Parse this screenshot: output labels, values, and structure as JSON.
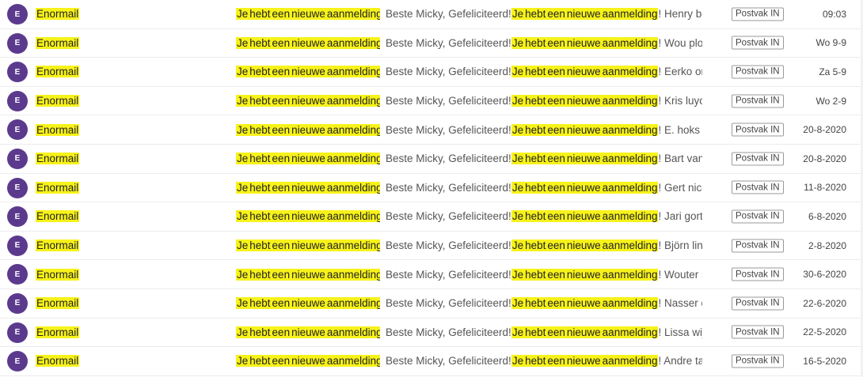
{
  "messages": [
    {
      "avatar": "E",
      "sender": "Enormail",
      "subject_words": [
        "Je",
        "hebt",
        "een",
        "nieuwe",
        "aanmelding"
      ],
      "subject_end": "!",
      "preview_lead": "Beste Micky, Gefeliciteerd!",
      "preview_words": [
        "Je",
        "hebt",
        "een",
        "nieuwe",
        "aanmelding"
      ],
      "preview_tail": "! Henry bok...",
      "folder": "Postvak IN",
      "date": "09:03"
    },
    {
      "avatar": "E",
      "sender": "Enormail",
      "subject_words": [
        "Je",
        "hebt",
        "een",
        "nieuwe",
        "aanmelding"
      ],
      "subject_end": "!",
      "preview_lead": "Beste Micky, Gefeliciteerd!",
      "preview_words": [
        "Je",
        "hebt",
        "een",
        "nieuwe",
        "aanmelding"
      ],
      "preview_tail": "! Wou plou...",
      "folder": "Postvak IN",
      "date": "Wo 9-9"
    },
    {
      "avatar": "E",
      "sender": "Enormail",
      "subject_words": [
        "Je",
        "hebt",
        "een",
        "nieuwe",
        "aanmelding"
      ],
      "subject_end": "!",
      "preview_lead": "Beste Micky, Gefeliciteerd!",
      "preview_words": [
        "Je",
        "hebt",
        "een",
        "nieuwe",
        "aanmelding"
      ],
      "preview_tail": "! Eerko orse...",
      "folder": "Postvak IN",
      "date": "Za 5-9"
    },
    {
      "avatar": "E",
      "sender": "Enormail",
      "subject_words": [
        "Je",
        "hebt",
        "een",
        "nieuwe",
        "aanmelding"
      ],
      "subject_end": "!",
      "preview_lead": "Beste Micky, Gefeliciteerd!",
      "preview_words": [
        "Je",
        "hebt",
        "een",
        "nieuwe",
        "aanmelding"
      ],
      "preview_tail": "! Kris luyckx...",
      "folder": "Postvak IN",
      "date": "Wo 2-9"
    },
    {
      "avatar": "E",
      "sender": "Enormail",
      "subject_words": [
        "Je",
        "hebt",
        "een",
        "nieuwe",
        "aanmelding"
      ],
      "subject_end": "!",
      "preview_lead": "Beste Micky, Gefeliciteerd!",
      "preview_words": [
        "Je",
        "hebt",
        "een",
        "nieuwe",
        "aanmelding"
      ],
      "preview_tail": "! E. hoks he...",
      "folder": "Postvak IN",
      "date": "20-8-2020"
    },
    {
      "avatar": "E",
      "sender": "Enormail",
      "subject_words": [
        "Je",
        "hebt",
        "een",
        "nieuwe",
        "aanmelding"
      ],
      "subject_end": "!",
      "preview_lead": "Beste Micky, Gefeliciteerd!",
      "preview_words": [
        "Je",
        "hebt",
        "een",
        "nieuwe",
        "aanmelding"
      ],
      "preview_tail": "! Bart van vr...",
      "folder": "Postvak IN",
      "date": "20-8-2020"
    },
    {
      "avatar": "E",
      "sender": "Enormail",
      "subject_words": [
        "Je",
        "hebt",
        "een",
        "nieuwe",
        "aanmelding"
      ],
      "subject_end": "!",
      "preview_lead": "Beste Micky, Gefeliciteerd!",
      "preview_words": [
        "Je",
        "hebt",
        "een",
        "nieuwe",
        "aanmelding"
      ],
      "preview_tail": "! Gert nicol...",
      "folder": "Postvak IN",
      "date": "11-8-2020"
    },
    {
      "avatar": "E",
      "sender": "Enormail",
      "subject_words": [
        "Je",
        "hebt",
        "een",
        "nieuwe",
        "aanmelding"
      ],
      "subject_end": "!",
      "preview_lead": "Beste Micky, Gefeliciteerd!",
      "preview_words": [
        "Je",
        "hebt",
        "een",
        "nieuwe",
        "aanmelding"
      ],
      "preview_tail": "! Jari gort h...",
      "folder": "Postvak IN",
      "date": "6-8-2020"
    },
    {
      "avatar": "E",
      "sender": "Enormail",
      "subject_words": [
        "Je",
        "hebt",
        "een",
        "nieuwe",
        "aanmelding"
      ],
      "subject_end": "!",
      "preview_lead": "Beste Micky, Gefeliciteerd!",
      "preview_words": [
        "Je",
        "hebt",
        "een",
        "nieuwe",
        "aanmelding"
      ],
      "preview_tail": "! Björn linke...",
      "folder": "Postvak IN",
      "date": "2-8-2020"
    },
    {
      "avatar": "E",
      "sender": "Enormail",
      "subject_words": [
        "Je",
        "hebt",
        "een",
        "nieuwe",
        "aanmelding"
      ],
      "subject_end": "!",
      "preview_lead": "Beste Micky, Gefeliciteerd!",
      "preview_words": [
        "Je",
        "hebt",
        "een",
        "nieuwe",
        "aanmelding"
      ],
      "preview_tail": "! Wouter ro...",
      "folder": "Postvak IN",
      "date": "30-6-2020"
    },
    {
      "avatar": "E",
      "sender": "Enormail",
      "subject_words": [
        "Je",
        "hebt",
        "een",
        "nieuwe",
        "aanmelding"
      ],
      "subject_end": "!",
      "preview_lead": "Beste Micky, Gefeliciteerd!",
      "preview_words": [
        "Je",
        "hebt",
        "een",
        "nieuwe",
        "aanmelding"
      ],
      "preview_tail": "! Nasser el ...",
      "folder": "Postvak IN",
      "date": "22-6-2020"
    },
    {
      "avatar": "E",
      "sender": "Enormail",
      "subject_words": [
        "Je",
        "hebt",
        "een",
        "nieuwe",
        "aanmelding"
      ],
      "subject_end": "!",
      "preview_lead": "Beste Micky, Gefeliciteerd!",
      "preview_words": [
        "Je",
        "hebt",
        "een",
        "nieuwe",
        "aanmelding"
      ],
      "preview_tail": "! Lissa wijne...",
      "folder": "Postvak IN",
      "date": "22-5-2020"
    },
    {
      "avatar": "E",
      "sender": "Enormail",
      "subject_words": [
        "Je",
        "hebt",
        "een",
        "nieuwe",
        "aanmelding"
      ],
      "subject_end": "!",
      "preview_lead": "Beste Micky, Gefeliciteerd!",
      "preview_words": [
        "Je",
        "hebt",
        "een",
        "nieuwe",
        "aanmelding"
      ],
      "preview_tail": "! Andre taal...",
      "folder": "Postvak IN",
      "date": "16-5-2020"
    }
  ]
}
